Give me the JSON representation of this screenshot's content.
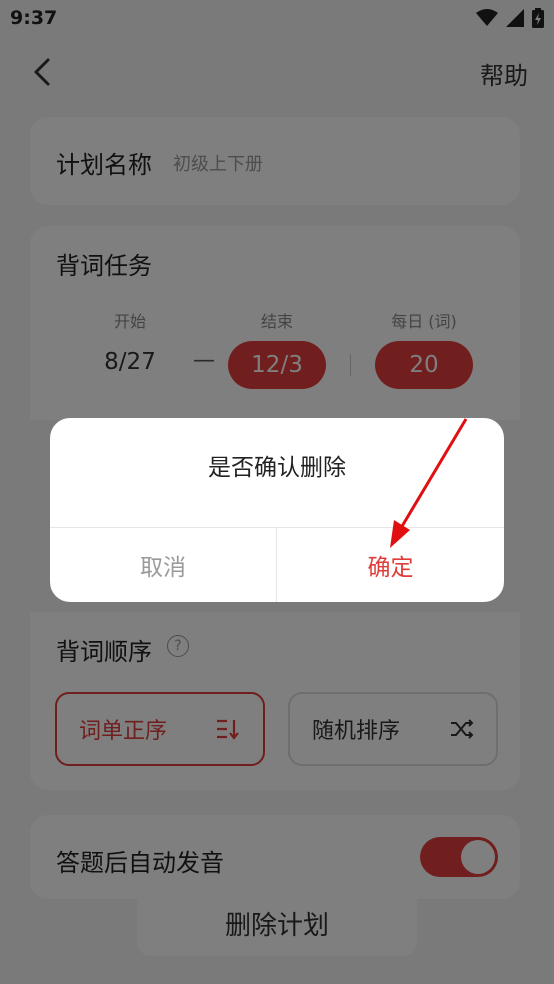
{
  "status": {
    "time": "9:37"
  },
  "header": {
    "help": "帮助"
  },
  "plan": {
    "name_label": "计划名称",
    "name_value": "初级上下册"
  },
  "task": {
    "title": "背词任务",
    "start_label": "开始",
    "end_label": "结束",
    "daily_label": "每日 (词)",
    "start_value": "8/27",
    "dash": "—",
    "end_value": "12/3",
    "daily_value": "20"
  },
  "order": {
    "title": "背词顺序",
    "help_mark": "?",
    "sequential": "词单正序",
    "random": "随机排序"
  },
  "audio": {
    "title": "答题后自动发音",
    "enabled": true
  },
  "delete": {
    "label": "删除计划"
  },
  "dialog": {
    "message": "是否确认删除",
    "cancel": "取消",
    "confirm": "确定"
  },
  "colors": {
    "accent": "#e03c3c",
    "annotation": "#e01010"
  }
}
